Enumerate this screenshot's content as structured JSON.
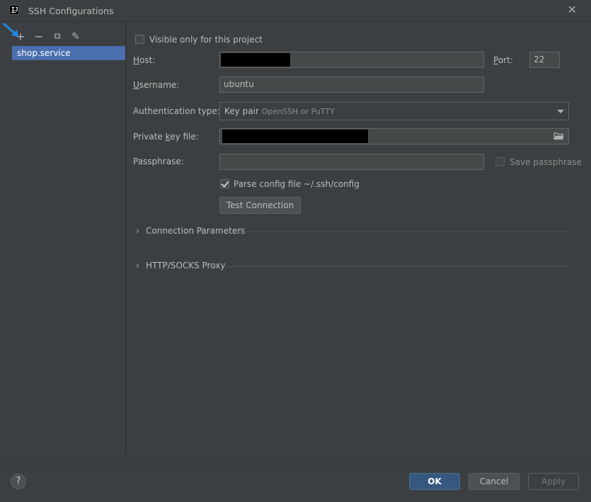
{
  "window": {
    "title": "SSH Configurations",
    "logo_text": "IJ"
  },
  "toolbar": {
    "add": "+",
    "remove": "−",
    "copy": "⧉",
    "edit": "✎"
  },
  "configs": [
    {
      "label": "shop.service"
    }
  ],
  "form": {
    "visible_only": {
      "label": "Visible only for this project",
      "checked": false
    },
    "host": {
      "label_prefix": "H",
      "label_rest": "ost:",
      "value": ""
    },
    "port": {
      "label_prefix": "P",
      "label_rest": "ort:",
      "value": "22"
    },
    "username": {
      "label_prefix": "U",
      "label_rest": "sername:",
      "value": "ubuntu"
    },
    "auth_type": {
      "label": "Authentication type:",
      "value": "Key pair",
      "hint": "OpenSSH or PuTTY"
    },
    "private_key": {
      "label_prefix": "Private ",
      "label_underline": "k",
      "label_rest": "ey file:",
      "value": ""
    },
    "passphrase": {
      "label": "Passphrase:",
      "value": ""
    },
    "save_passphrase": {
      "label": "Save passphrase",
      "checked": false
    },
    "parse_config": {
      "label": "Parse config file ~/.ssh/config",
      "checked": true
    },
    "test_connection": "Test Connection"
  },
  "sections": [
    {
      "label": "Connection Parameters",
      "expanded": false
    },
    {
      "label": "HTTP/SOCKS Proxy",
      "expanded": false
    }
  ],
  "footer": {
    "help": "?",
    "ok": "OK",
    "cancel": "Cancel",
    "apply": "Apply"
  },
  "colors": {
    "accent": "#4b6eaf",
    "primary_button": "#365880",
    "arrow_annotation": "#1e88e5"
  }
}
